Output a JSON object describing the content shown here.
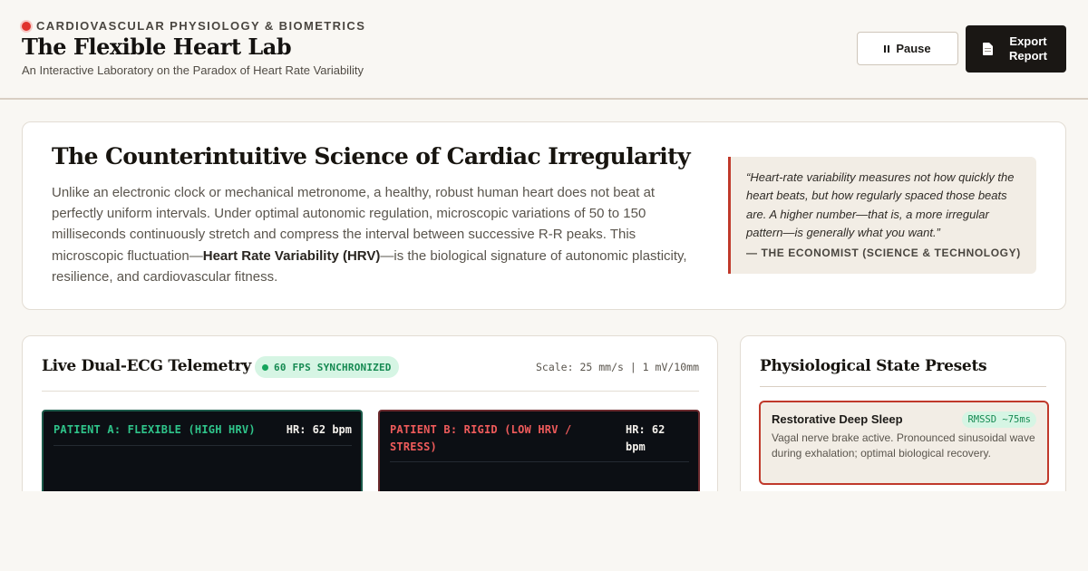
{
  "header": {
    "eyebrow": "CARDIOVASCULAR PHYSIOLOGY & BIOMETRICS",
    "title": "The Flexible Heart Lab",
    "subtitle": "An Interactive Laboratory on the Paradox of Heart Rate Variability",
    "pause_label": "Pause",
    "export_label": "Export Report",
    "icons": {
      "pause": "pause-icon",
      "export": "document-icon",
      "live": "live-indicator-dot"
    }
  },
  "intro": {
    "title": "The Counterintuitive Science of Cardiac Irregularity",
    "body_before": "Unlike an electronic clock or mechanical metronome, a healthy, robust human heart does not beat at perfectly uniform intervals. Under optimal autonomic regulation, microscopic variations of 50 to 150 milliseconds continuously stretch and compress the interval between successive R-R peaks. This microscopic fluctuation—",
    "body_emphasis": "Heart Rate Variability (HRV)",
    "body_after": "—is the biological signature of autonomic plasticity, resilience, and cardiovascular fitness.",
    "quote": "“Heart-rate variability measures not how quickly the heart beats, but how regularly spaced those beats are. A higher number—that is, a more irregular pattern—is generally what you want.”",
    "quote_source": "— THE ECONOMIST (SCIENCE & TECHNOLOGY)"
  },
  "telemetry": {
    "title": "Live Dual-ECG Telemetry",
    "fps_badge": "60 FPS SYNCHRONIZED",
    "scale": "Scale: 25 mm/s | 1 mV/10mm",
    "patient_a": {
      "label": "PATIENT A: FLEXIBLE (HIGH HRV)",
      "hr": "HR: 62 bpm"
    },
    "patient_b": {
      "label": "PATIENT B: RIGID (LOW HRV / STRESS)",
      "hr": "HR: 62 bpm"
    }
  },
  "presets": {
    "title": "Physiological State Presets",
    "items": [
      {
        "name": "Restorative Deep Sleep",
        "badge": "RMSSD ~75ms",
        "description": "Vagal nerve brake active. Pronounced sinusoidal wave during exhalation; optimal biological recovery.",
        "selected": true
      }
    ]
  },
  "colors": {
    "accent_red": "#c0392b",
    "live_dot": "#e0322c",
    "good_green": "#168a52",
    "patient_a": "#2fc48a",
    "patient_b": "#ef5b5b",
    "ecg_background": "#0c0f14",
    "page_background": "#f9f7f3"
  }
}
